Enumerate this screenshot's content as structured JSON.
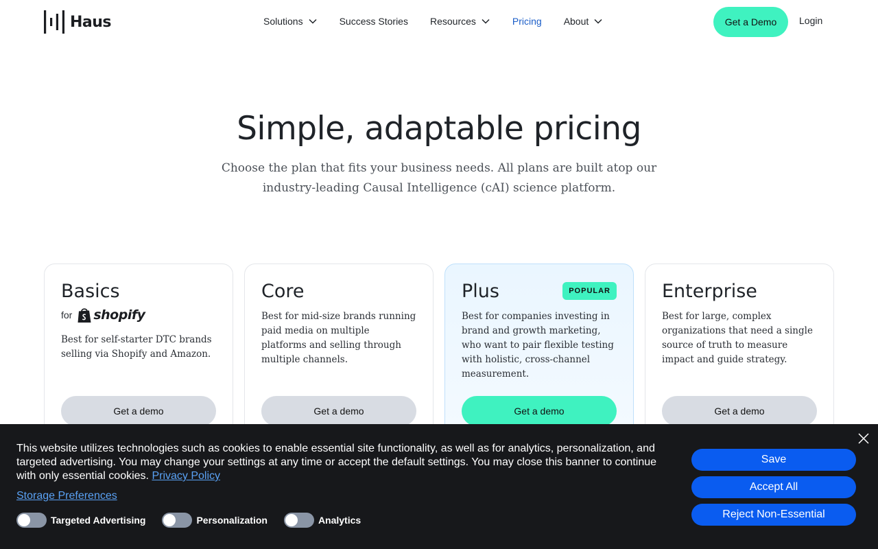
{
  "header": {
    "logo_text": "Haus",
    "nav": [
      {
        "label": "Solutions",
        "has_dropdown": true
      },
      {
        "label": "Success Stories",
        "has_dropdown": false
      },
      {
        "label": "Resources",
        "has_dropdown": true
      },
      {
        "label": "Pricing",
        "has_dropdown": false,
        "active": true
      },
      {
        "label": "About",
        "has_dropdown": true
      }
    ],
    "demo_button": "Get a Demo",
    "login": "Login"
  },
  "hero": {
    "title": "Simple, adaptable pricing",
    "subtitle": "Choose the plan that fits your business needs. All plans are built atop our industry-leading Causal Intelligence (cAI) science platform."
  },
  "plans": [
    {
      "name": "Basics",
      "for_text": "for",
      "partner_logo": "shopify",
      "description": "Best for self-starter DTC brands selling via Shopify and Amazon.",
      "button": "Get a demo"
    },
    {
      "name": "Core",
      "description": "Best for mid-size brands running paid media on multiple platforms and selling through multiple channels.",
      "button": "Get a demo"
    },
    {
      "name": "Plus",
      "badge": "POPULAR",
      "description": "Best for companies investing in brand and growth marketing, who want to pair flexible testing with holistic, cross-channel measurement.",
      "button": "Get a demo"
    },
    {
      "name": "Enterprise",
      "description": "Best for large, complex organizations that need a single source of truth to measure impact and guide strategy.",
      "button": "Get a demo"
    }
  ],
  "cookie_banner": {
    "text": "This website utilizes technologies such as cookies to enable essential site functionality, as well as for analytics, personalization, and targeted advertising. You may change your settings at any time or accept the default settings. You may close this banner to continue with only essential cookies.",
    "privacy_link": "Privacy Policy",
    "storage_link": "Storage Preferences",
    "toggles": [
      {
        "label": "Targeted Advertising",
        "on": false
      },
      {
        "label": "Personalization",
        "on": false
      },
      {
        "label": "Analytics",
        "on": false
      }
    ],
    "buttons": {
      "save": "Save",
      "accept_all": "Accept All",
      "reject": "Reject Non-Essential"
    }
  },
  "colors": {
    "accent": "#3ff2c0",
    "link_active": "#1a5dc8",
    "banner_bg": "#17181b",
    "banner_button": "#0a5cf0"
  },
  "icons": [
    "haus-logo-icon",
    "chevron-down-icon",
    "shopify-bag-icon",
    "close-icon"
  ]
}
